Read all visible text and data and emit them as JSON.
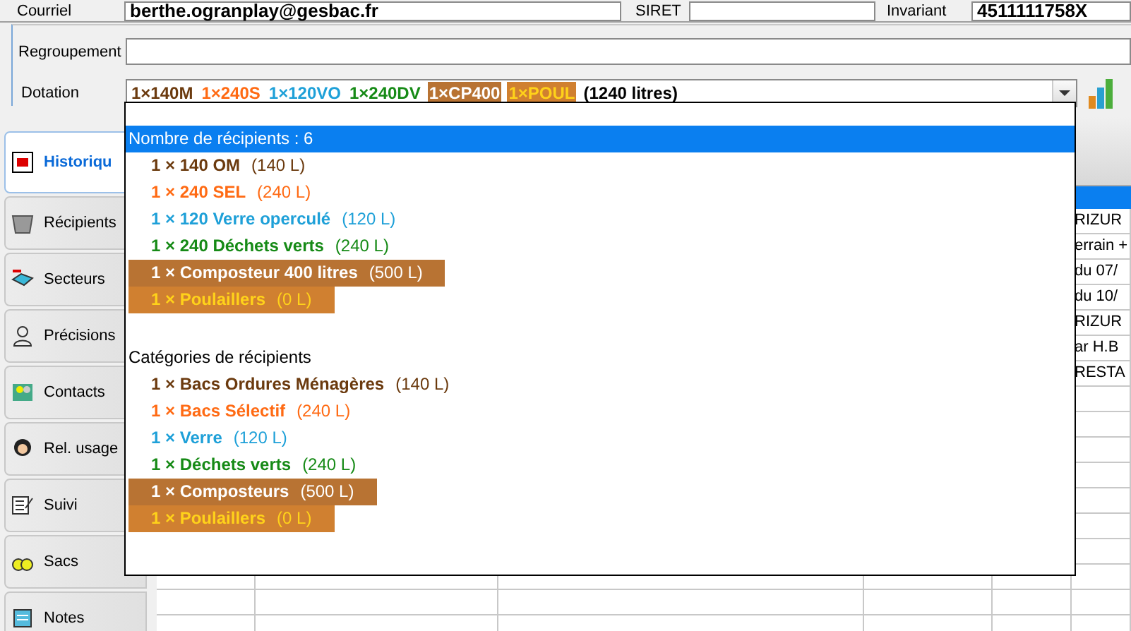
{
  "contact_row": {
    "email_label": "Courriel",
    "email": "berthe.ogranplay@gesbac.fr",
    "siret_label": "SIRET",
    "invariant_label": "Invariant",
    "invariant": "4511111758X"
  },
  "regroupement": {
    "label": "Regroupement"
  },
  "dotation": {
    "label": "Dotation",
    "segments": [
      {
        "text": "1×140M",
        "kind": "text",
        "color": "#6b3a0e"
      },
      {
        "text": "1×240S",
        "kind": "text",
        "color": "#ff6a13"
      },
      {
        "text": "1×120VO",
        "kind": "text",
        "color": "#1ea0d8"
      },
      {
        "text": "1×240DV",
        "kind": "text",
        "color": "#168a16"
      },
      {
        "text": "1×CP400",
        "kind": "band",
        "color": "#b87333"
      },
      {
        "text": "1×POUL",
        "kind": "band_accent",
        "color": "#d08030"
      }
    ],
    "total": "(1240 litres)"
  },
  "dropdown": {
    "sections": [
      {
        "title": "Nombre de récipients : 6",
        "selected": true,
        "items": [
          {
            "name": "1 × 140 OM",
            "volume": "(140 L)",
            "kind": "text",
            "color": "#6b3a0e"
          },
          {
            "name": "1 × 240 SEL",
            "volume": "(240 L)",
            "kind": "text",
            "color": "#ff6a13"
          },
          {
            "name": "1 × 120 Verre operculé",
            "volume": "(120 L)",
            "kind": "text",
            "color": "#1ea0d8"
          },
          {
            "name": "1 × 240 Déchets verts",
            "volume": "(240 L)",
            "kind": "text",
            "color": "#168a16"
          },
          {
            "name": "1 × Composteur 400 litres",
            "volume": "(500 L)",
            "kind": "band",
            "color": "#b87333"
          },
          {
            "name": "1 × Poulaillers",
            "volume": "(0 L)",
            "kind": "band_accent",
            "color": "#d08030"
          }
        ]
      },
      {
        "title": "Catégories de récipients",
        "selected": false,
        "items": [
          {
            "name": "1 × Bacs Ordures Ménagères",
            "volume": "(140 L)",
            "kind": "text",
            "color": "#6b3a0e"
          },
          {
            "name": "1 × Bacs Sélectif",
            "volume": "(240 L)",
            "kind": "text",
            "color": "#ff6a13"
          },
          {
            "name": "1 × Verre",
            "volume": "(120 L)",
            "kind": "text",
            "color": "#1ea0d8"
          },
          {
            "name": "1 × Déchets verts",
            "volume": "(240 L)",
            "kind": "text",
            "color": "#168a16"
          },
          {
            "name": "1 × Composteurs",
            "volume": "(500 L)",
            "kind": "band",
            "color": "#b87333"
          },
          {
            "name": "1 × Poulaillers",
            "volume": "(0 L)",
            "kind": "band_accent",
            "color": "#d08030"
          }
        ]
      }
    ]
  },
  "tabs": [
    {
      "label": "Historiqu",
      "selected": true
    },
    {
      "label": "Récipients",
      "selected": false
    },
    {
      "label": "Secteurs",
      "selected": false
    },
    {
      "label": "Précisions",
      "selected": false
    },
    {
      "label": "Contacts",
      "selected": false
    },
    {
      "label": "Rel. usage",
      "selected": false
    },
    {
      "label": "Suivi",
      "selected": false
    },
    {
      "label": "Sacs",
      "selected": false
    },
    {
      "label": "Notes",
      "selected": false
    }
  ],
  "table": {
    "rows": [
      {
        "column_6": "RIZUR"
      },
      {
        "column_6": "errain +"
      },
      {
        "column_6": "du 07/"
      },
      {
        "column_6": "du 10/"
      },
      {
        "column_6": "RIZUR"
      },
      {
        "column_6": "ar H.B"
      },
      {
        "column_6": "RESTA"
      }
    ]
  }
}
